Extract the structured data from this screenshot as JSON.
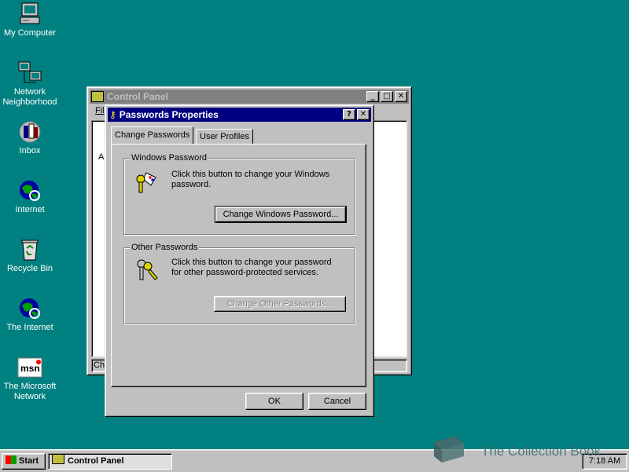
{
  "desktop": {
    "icons": [
      {
        "label": "My Computer",
        "icon": "my-computer-icon"
      },
      {
        "label": "Network\nNeighborhood",
        "icon": "network-icon"
      },
      {
        "label": "Inbox",
        "icon": "inbox-icon"
      },
      {
        "label": "Internet",
        "icon": "internet-icon"
      },
      {
        "label": "Recycle Bin",
        "icon": "recycle-bin-icon"
      },
      {
        "label": "The Internet",
        "icon": "internet-icon"
      },
      {
        "label": "The Microsoft\nNetwork",
        "icon": "msn-icon"
      }
    ]
  },
  "control_panel": {
    "title": "Control Panel",
    "menu_fragment": "Fil",
    "content_fragment": "A",
    "status_fragment": "Ch"
  },
  "dialog": {
    "title": "Passwords Properties",
    "help_btn": "?",
    "close_btn": "✕",
    "tabs": [
      "Change Passwords",
      "User Profiles"
    ],
    "windows_group": {
      "label": "Windows Password",
      "text": "Click this button to change your Windows password.",
      "button": "Change Windows Password..."
    },
    "other_group": {
      "label": "Other Passwords",
      "text": "Click this button to change your password for other password-protected services.",
      "button": "Change Other Passwords..."
    },
    "ok": "OK",
    "cancel": "Cancel"
  },
  "taskbar": {
    "start": "Start",
    "task": "Control Panel",
    "clock": "7:18 AM"
  },
  "watermark": "The Collection Book",
  "colors": {
    "desktop": "#008080",
    "title_active": "#000080",
    "face": "#c0c0c0"
  }
}
